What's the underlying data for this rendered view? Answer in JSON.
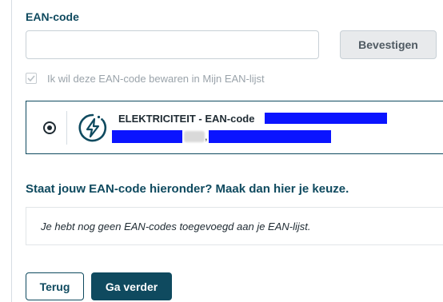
{
  "ean_field": {
    "label": "EAN-code",
    "value": "",
    "placeholder": "",
    "confirm_label": "Bevestigen"
  },
  "save_option": {
    "label": "Ik wil deze EAN-code bewaren in Mijn EAN-lijst",
    "checked": true,
    "disabled": true
  },
  "selected_card": {
    "title": "ELEKTRICITEIT - EAN-code",
    "address_separator": ",",
    "selected": true,
    "icon": "electricity-icon"
  },
  "list_section": {
    "title": "Staat jouw EAN-code hieronder? Maak dan hier je keuze.",
    "empty_message": "Je hebt nog geen EAN-codes toegevoegd aan je EAN-lijst."
  },
  "actions": {
    "back_label": "Terug",
    "next_label": "Ga verder"
  },
  "colors": {
    "primary": "#0f4a5f",
    "disabled_button_bg": "#e8eaec",
    "redaction": "#0a14ff"
  }
}
